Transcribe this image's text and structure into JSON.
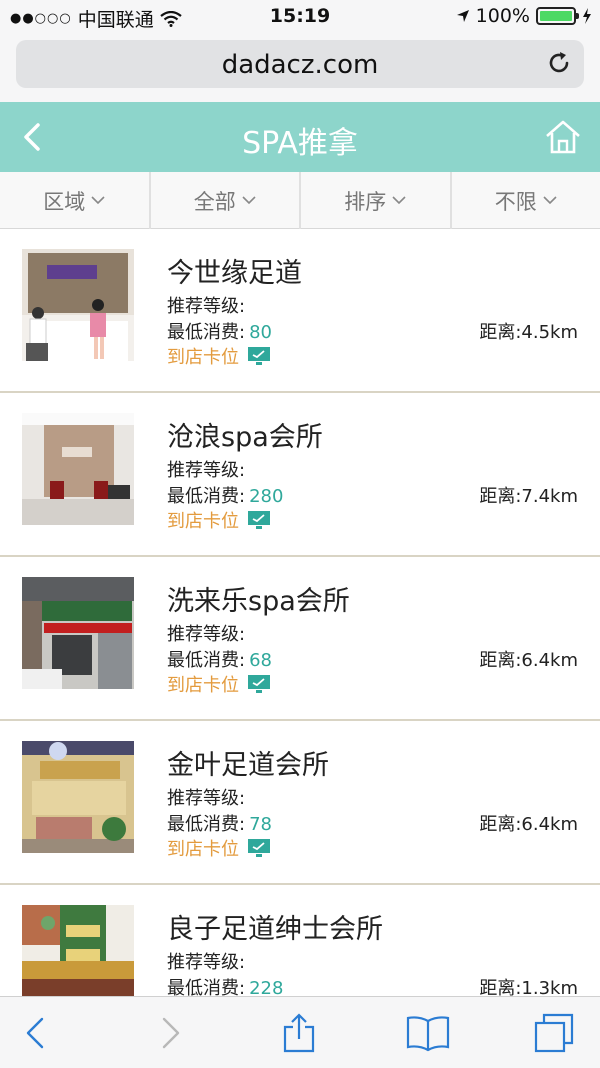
{
  "status_bar": {
    "carrier": "中国联通",
    "time": "15:19",
    "battery": "100%"
  },
  "browser": {
    "url": "dadacz.com"
  },
  "header": {
    "title": "SPA推拿"
  },
  "filters": [
    {
      "label": "区域"
    },
    {
      "label": "全部"
    },
    {
      "label": "排序"
    },
    {
      "label": "不限"
    }
  ],
  "labels": {
    "rating": "推荐等级:",
    "min_price": "最低消费:",
    "distance": "距离:",
    "booking": "到店卡位"
  },
  "stores": [
    {
      "name": "今世缘足道",
      "min_price": "80",
      "distance": "4.5km"
    },
    {
      "name": "沧浪spa会所",
      "min_price": "280",
      "distance": "7.4km"
    },
    {
      "name": "洗来乐spa会所",
      "min_price": "68",
      "distance": "6.4km"
    },
    {
      "name": "金叶足道会所",
      "min_price": "78",
      "distance": "6.4km"
    },
    {
      "name": "良子足道绅士会所",
      "min_price": "228",
      "distance": "1.3km"
    }
  ],
  "colors": {
    "header_bg": "#8dd5cb",
    "accent_teal": "#2fa89b",
    "booking_orange": "#e39b3e"
  },
  "icons": {
    "back": "chevron-left-icon",
    "home": "home-icon",
    "booking": "monitor-icon",
    "reload": "reload-icon"
  }
}
